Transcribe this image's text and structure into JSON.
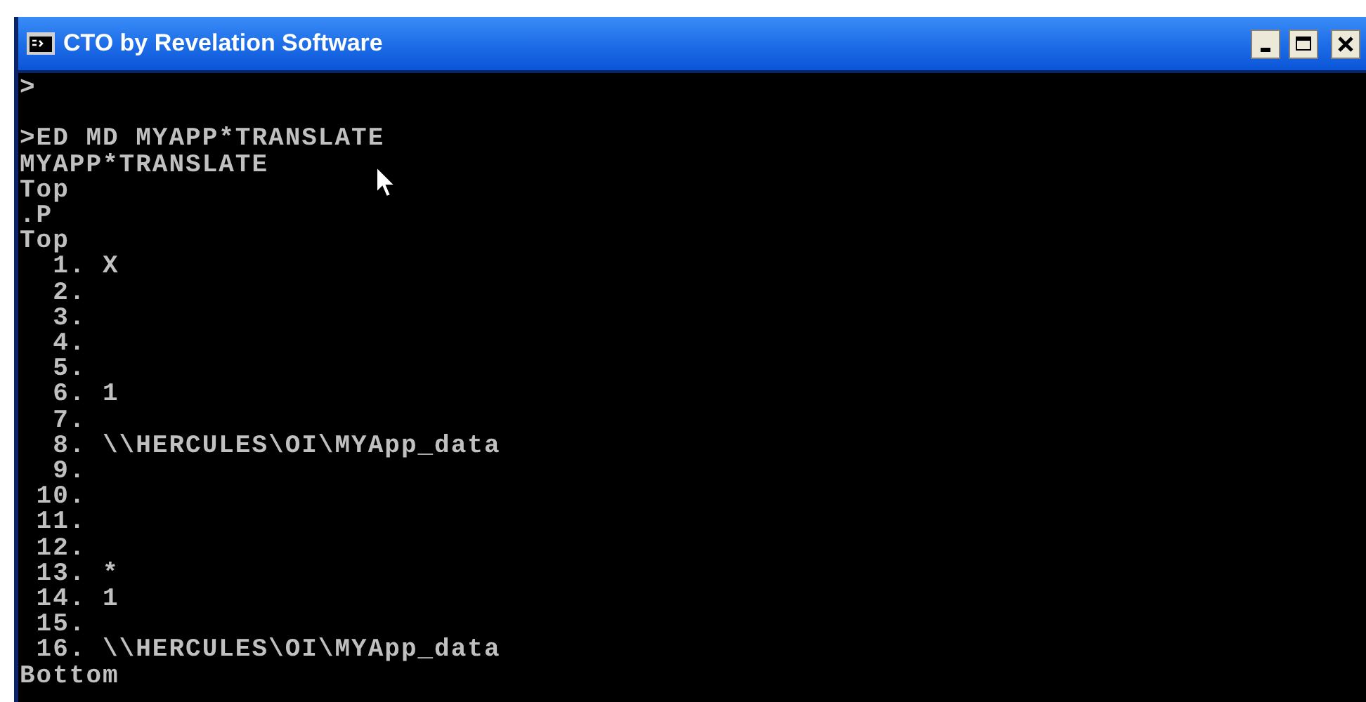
{
  "window": {
    "title": "CTO by Revelation Software"
  },
  "console": {
    "blocks": [
      [
        ">"
      ],
      [
        ">ED MD MYAPP*TRANSLATE",
        "MYAPP*TRANSLATE",
        "Top",
        ".P",
        "Top",
        "  1. X",
        "  2.",
        "  3.",
        "  4.",
        "  5.",
        "  6. 1",
        "  7.",
        "  8. \\\\HERCULES\\OI\\MYApp_data",
        "  9.",
        " 10.",
        " 11.",
        " 12.",
        " 13. *",
        " 14. 1",
        " 15.",
        " 16. \\\\HERCULES\\OI\\MYApp_data",
        "Bottom"
      ]
    ]
  }
}
